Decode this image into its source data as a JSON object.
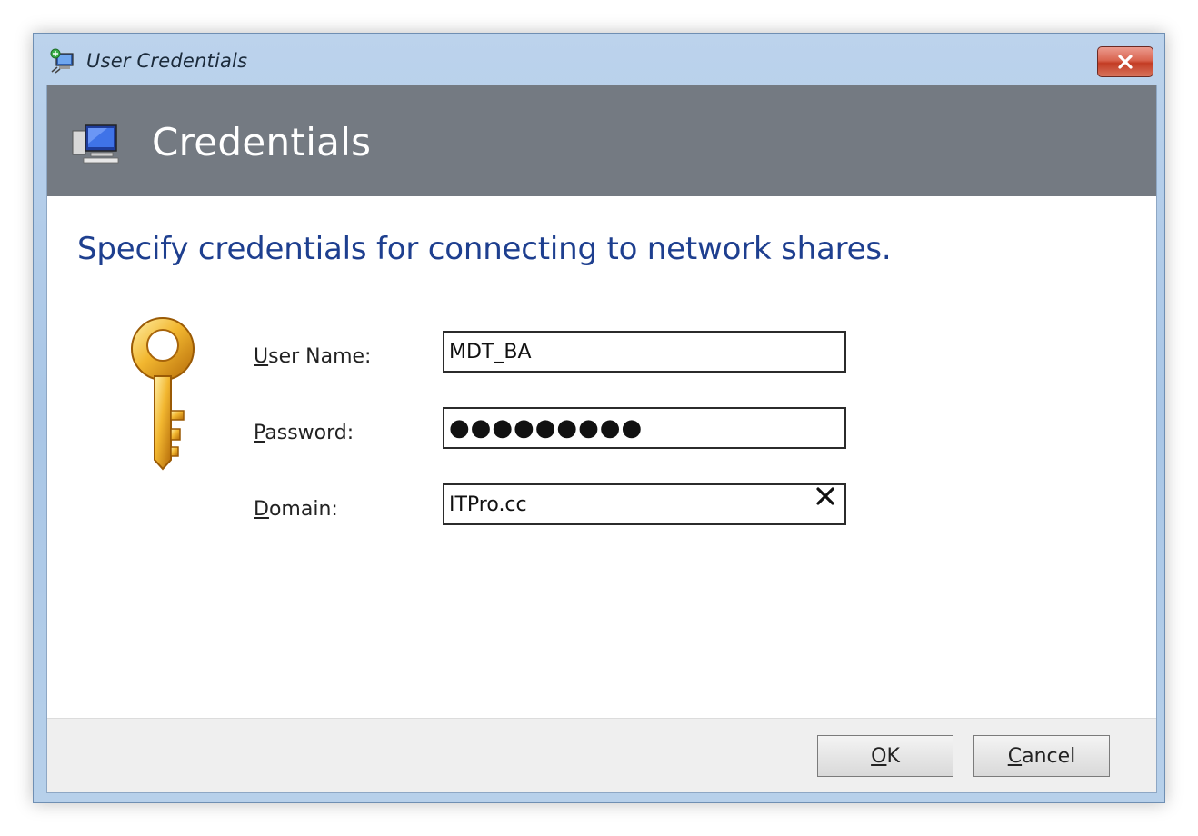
{
  "window": {
    "title": "User Credentials"
  },
  "banner": {
    "title": "Credentials"
  },
  "instruction": "Specify credentials for connecting to network shares.",
  "form": {
    "username": {
      "label_accel": "U",
      "label_rest": "ser Name:",
      "value": "MDT_BA"
    },
    "password": {
      "label_accel": "P",
      "label_rest": "assword:",
      "value": "●●●●●●●●●"
    },
    "domain": {
      "label_accel": "D",
      "label_rest": "omain:",
      "value": "ITPro.cc"
    }
  },
  "buttons": {
    "ok_accel": "O",
    "ok_rest": "K",
    "cancel_accel": "C",
    "cancel_rest": "ancel"
  },
  "icons": {
    "app": "network-computer-icon",
    "banner": "computer-monitor-icon",
    "key": "key-icon",
    "close": "close-icon",
    "clear": "clear-field-icon"
  },
  "colors": {
    "banner_bg": "#747a82",
    "instruction_text": "#1e3f8f",
    "close_button": "#c33c24",
    "key_gold": "#e8a51a"
  }
}
